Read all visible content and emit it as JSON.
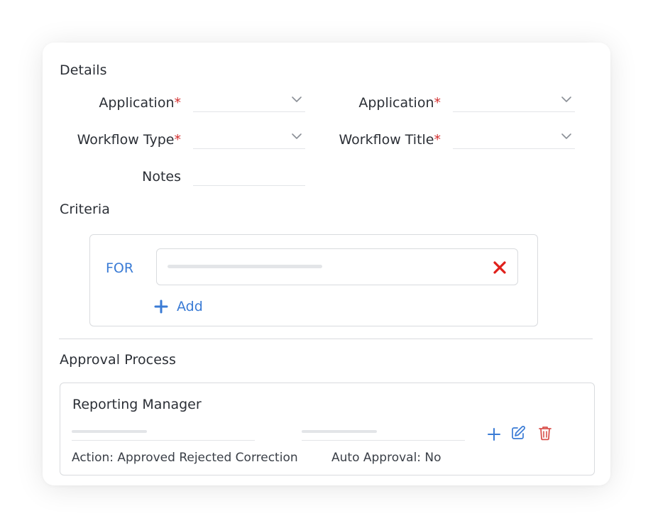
{
  "details": {
    "title": "Details",
    "fields": [
      {
        "label": "Application",
        "required_mark": "*",
        "type": "select"
      },
      {
        "label": "Application",
        "required_mark": "*",
        "type": "select"
      },
      {
        "label": "Workflow Type",
        "required_mark": "*",
        "type": "select"
      },
      {
        "label": "Workflow Title",
        "required_mark": "*",
        "type": "select"
      },
      {
        "label": "Notes",
        "type": "text"
      }
    ]
  },
  "criteria": {
    "title": "Criteria",
    "for_label": "FOR",
    "add_label": "Add"
  },
  "approval": {
    "title": "Approval Process",
    "step_title": "Reporting Manager",
    "action_text": "Action: Approved Rejected Correction",
    "auto_approval_text": "Auto Approval: No"
  },
  "colors": {
    "accent": "#3a7bd5",
    "required": "#d32f2f",
    "remove": "#e0201b",
    "delete": "#d9534f",
    "border": "#d9dbde"
  },
  "icons": [
    "chevron-down-icon",
    "close-icon",
    "plus-icon",
    "edit-icon",
    "trash-icon"
  ]
}
